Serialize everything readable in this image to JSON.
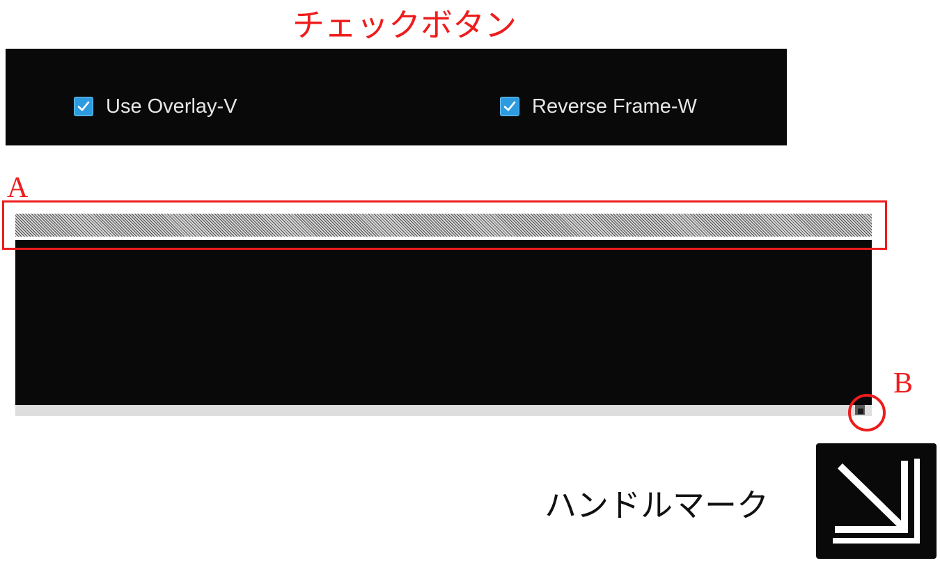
{
  "annotations": {
    "checkbox_section_title": "チェックボタン",
    "marker_a": "A",
    "marker_b": "B",
    "handle_mark_label": "ハンドルマーク"
  },
  "checkbox_panel": {
    "items": [
      {
        "label": "Use Overlay-V",
        "checked": true
      },
      {
        "label": "Reverse Frame-W",
        "checked": true
      }
    ]
  },
  "colors": {
    "annotation_red": "#ee1c1c",
    "panel_background": "#090909",
    "checkbox_fill": "#2d9be0",
    "strip_gray": "#dedede"
  },
  "icons": {
    "checkbox": "checkmark-icon",
    "resize_handle": "resize-diagonal-arrow-icon"
  }
}
